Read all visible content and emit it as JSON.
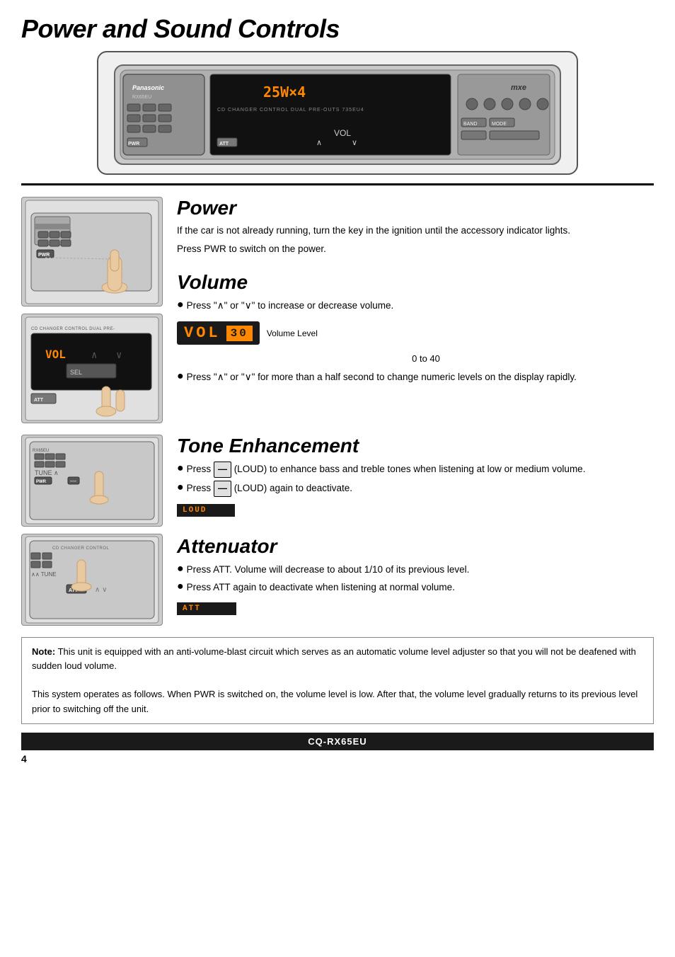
{
  "page": {
    "title": "Power and Sound Controls",
    "page_number": "4",
    "bottom_bar_label": "CQ-RX65EU"
  },
  "power_section": {
    "heading": "Power",
    "text1": "If the car is not already running, turn the key in the ignition until the accessory indicator lights.",
    "text2": "Press PWR to switch on the power."
  },
  "volume_section": {
    "heading": "Volume",
    "bullet1": "Press \"/\\\" or \"\\/\" to increase or decrease volume.",
    "display_vol": "VOL",
    "display_level": "30",
    "display_label": "Volume Level",
    "range": "0 to 40",
    "bullet2": "Press  \"/\\\" or \"\\/\" for  more than a half second to change numeric levels on the display rapidly."
  },
  "tone_section": {
    "heading": "Tone Enhancement",
    "bullet1": "Press      (LOUD) to enhance bass and treble tones when listening at low or medium volume.",
    "bullet2": "Press      (LOUD) again to deactivate.",
    "loud_label": "LOUD"
  },
  "attenuator_section": {
    "heading": "Attenuator",
    "bullet1": "Press ATT. Volume will decrease to about 1/10 of its previous level.",
    "bullet2": "Press ATT again to deactivate when listening at normal volume.",
    "att_label": "ATT"
  },
  "note": {
    "label": "Note:",
    "text1": "This unit is equipped with an anti-volume-blast circuit which serves as an automatic volume level adjuster so that you will not be deafened with sudden loud volume.",
    "text2": "This system operates as follows. When PWR is switched on, the volume level is low. After that, the volume level gradually returns to its previous level prior to switching off the unit."
  }
}
